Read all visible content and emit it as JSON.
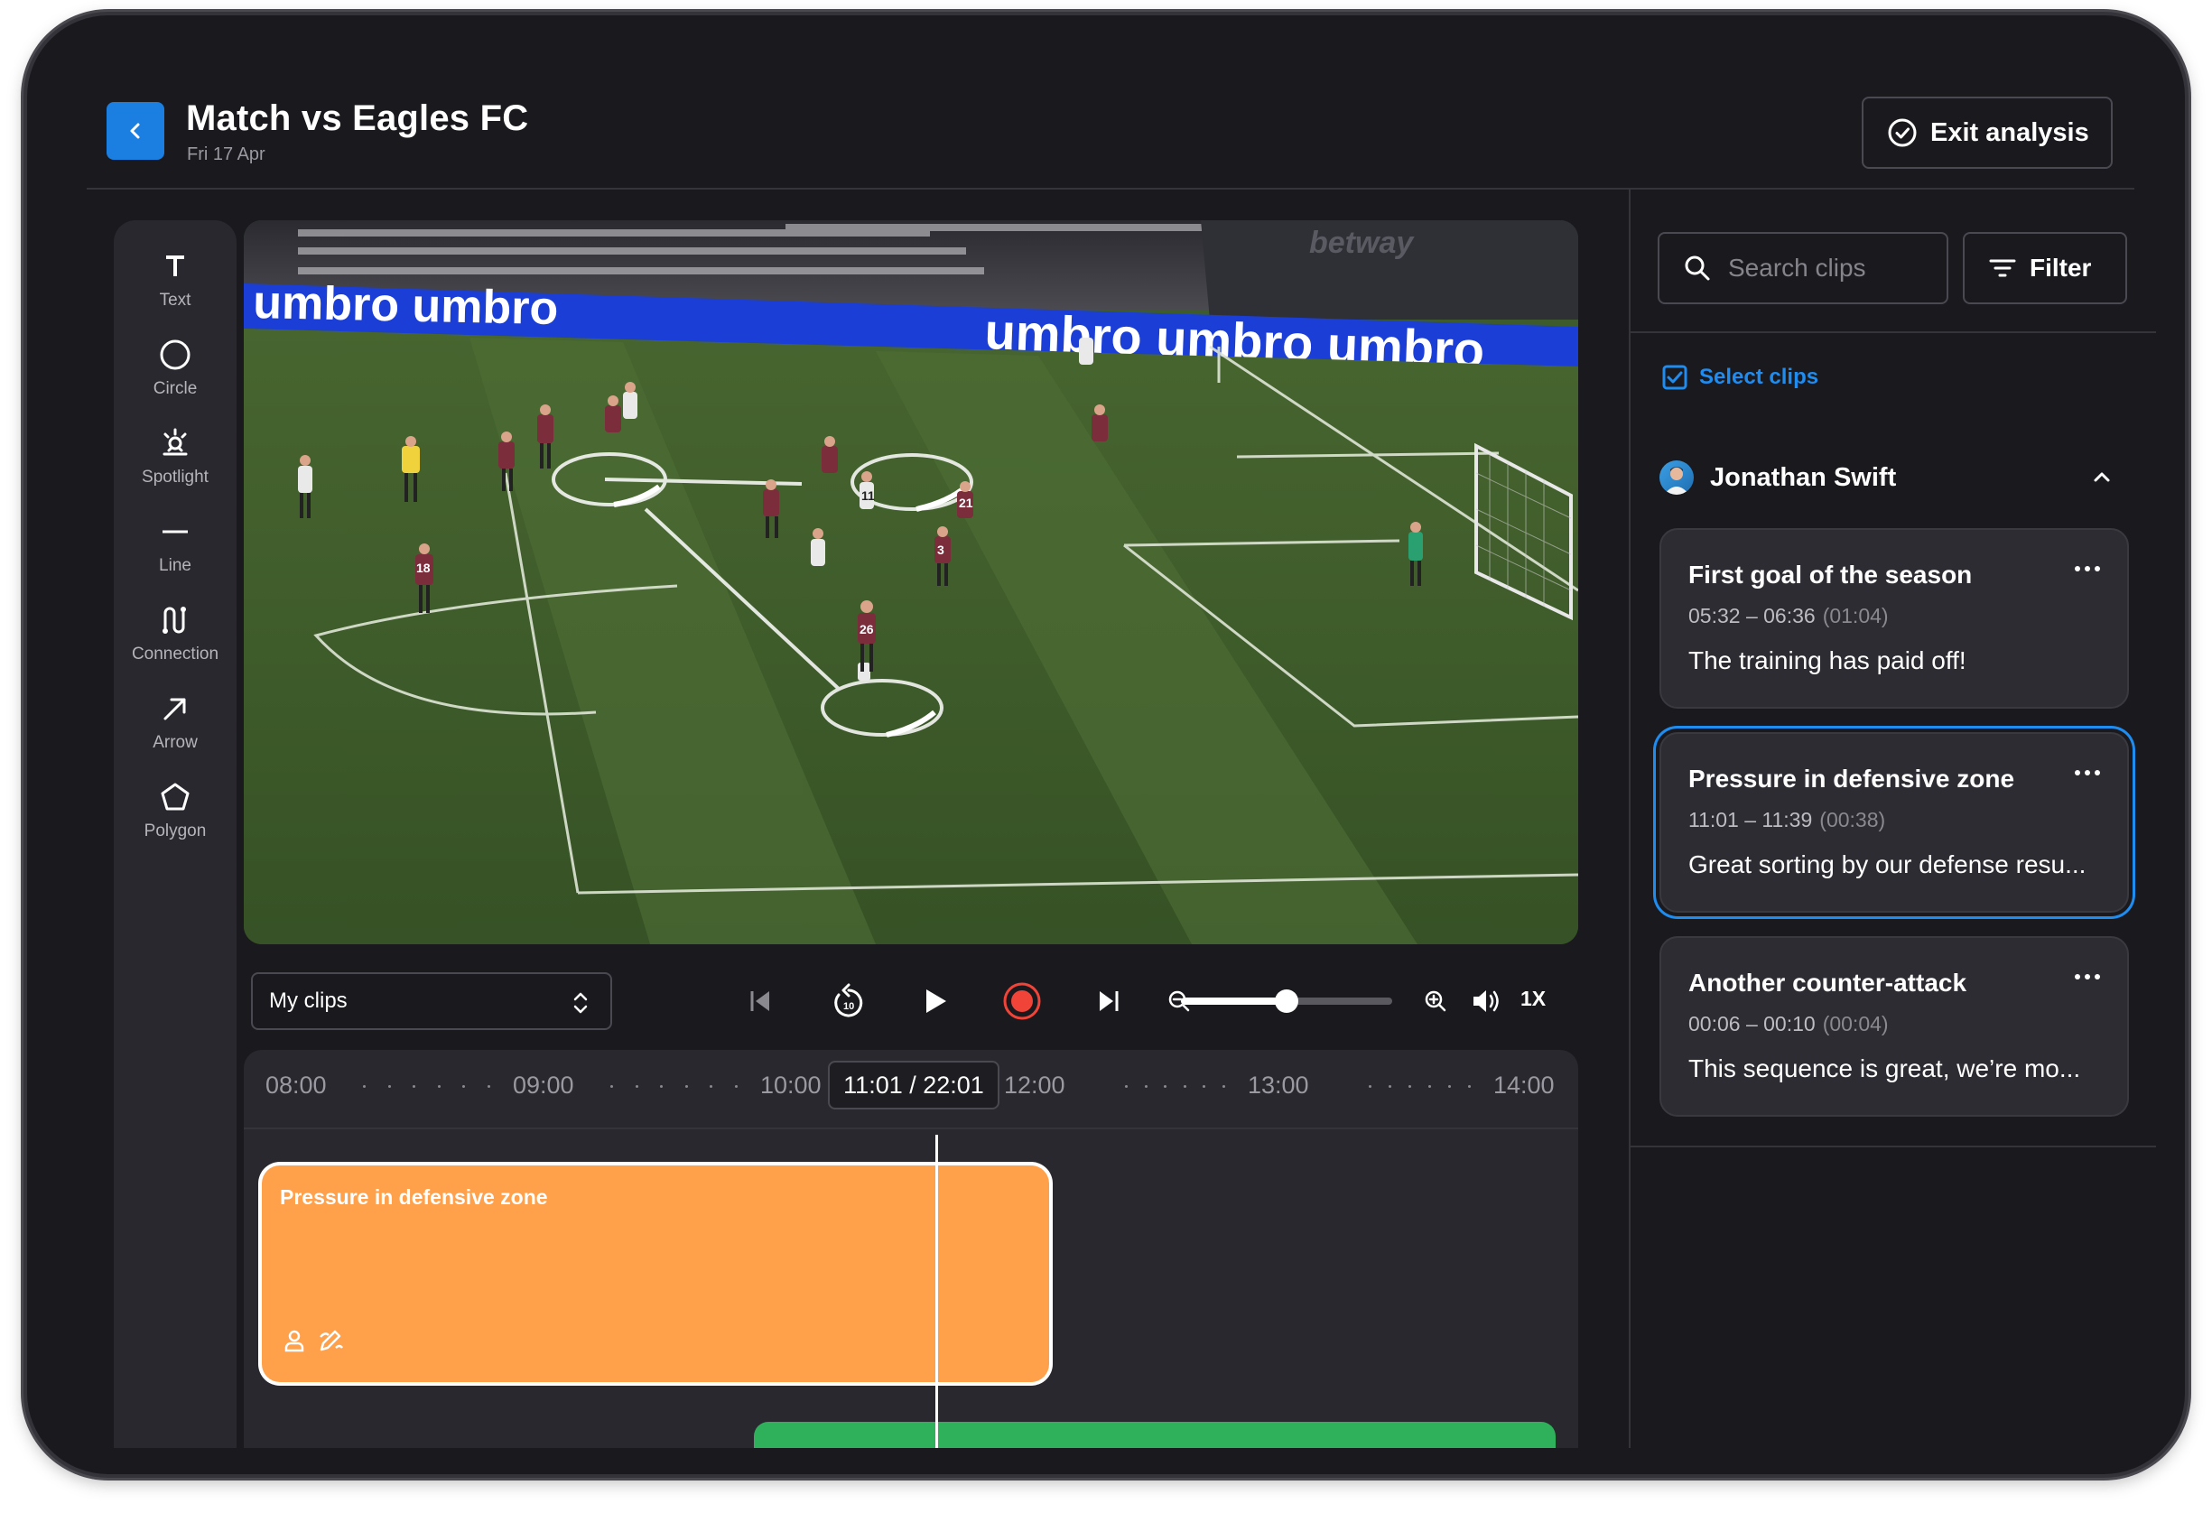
{
  "header": {
    "title": "Match vs Eagles FC",
    "date": "Fri 17 Apr",
    "exit_label": "Exit analysis"
  },
  "tools": [
    {
      "label": "Text",
      "icon": "text-icon"
    },
    {
      "label": "Circle",
      "icon": "circle-icon"
    },
    {
      "label": "Spotlight",
      "icon": "spotlight-icon"
    },
    {
      "label": "Line",
      "icon": "line-icon"
    },
    {
      "label": "Connection",
      "icon": "connection-icon"
    },
    {
      "label": "Arrow",
      "icon": "arrow-icon"
    },
    {
      "label": "Polygon",
      "icon": "polygon-icon"
    }
  ],
  "video": {
    "banners": [
      "umbro umbro",
      "umbro umbro umbro",
      "betway"
    ],
    "player_numbers": [
      "18",
      "11",
      "3",
      "21",
      "26"
    ]
  },
  "controls": {
    "clips_select": "My clips",
    "speed": "1X",
    "zoom_fraction": 0.5,
    "record_color": "#f04438"
  },
  "timeline": {
    "ticks": [
      "08:00",
      "09:00",
      "10:00",
      "12:00",
      "13:00",
      "14:00"
    ],
    "current_time": "11:01",
    "total_time": "22:01",
    "clip_name": "Pressure in defensive zone",
    "clip_color": "#ffa04a",
    "second_clip_color": "#2fb05a"
  },
  "sidebar": {
    "search_placeholder": "Search clips",
    "filter_label": "Filter",
    "select_clips_label": "Select clips",
    "user_name": "Jonathan Swift",
    "accent": "#1f8cf0",
    "clips": [
      {
        "title": "First goal of the season",
        "range": "05:32 – 06:36",
        "duration": "(01:04)",
        "note": "The training has paid off!"
      },
      {
        "title": "Pressure in defensive zone",
        "range": "11:01 – 11:39",
        "duration": "(00:38)",
        "note": "Great sorting by our defense resu...",
        "active": true
      },
      {
        "title": "Another counter-attack",
        "range": "00:06 – 00:10",
        "duration": "(00:04)",
        "note": "This sequence is great, we’re mo..."
      }
    ]
  }
}
